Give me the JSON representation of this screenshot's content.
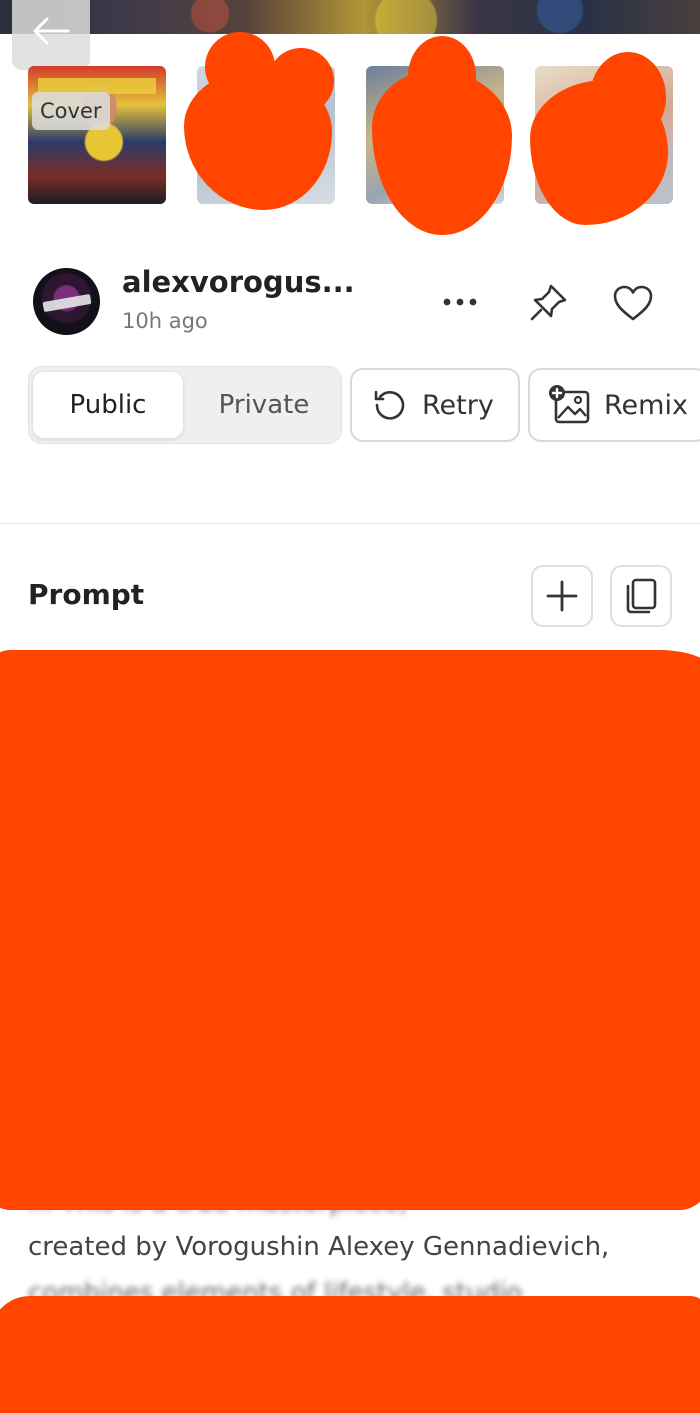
{
  "header": {
    "back_icon": "arrow-left-icon"
  },
  "gallery": {
    "cover_label": "Cover"
  },
  "post": {
    "username": "alexvorogus...",
    "timestamp": "10h ago",
    "icons": [
      "more-horizontal-icon",
      "pin-icon",
      "heart-icon"
    ]
  },
  "visibility": {
    "options": [
      "Public",
      "Private"
    ],
    "selected": "Public"
  },
  "actions": {
    "retry_label": "Retry",
    "remix_label": "Remix"
  },
  "prompt": {
    "title": "Prompt",
    "visible_line": "created by Vorogushin Alexey Gennadievich,",
    "blurred_above": "... This is a true masterpiece,",
    "blurred_below": "combines elements of lifestyle, studio"
  },
  "colors": {
    "redaction": "#ff4500",
    "accent_border": "#d9d9d9"
  }
}
